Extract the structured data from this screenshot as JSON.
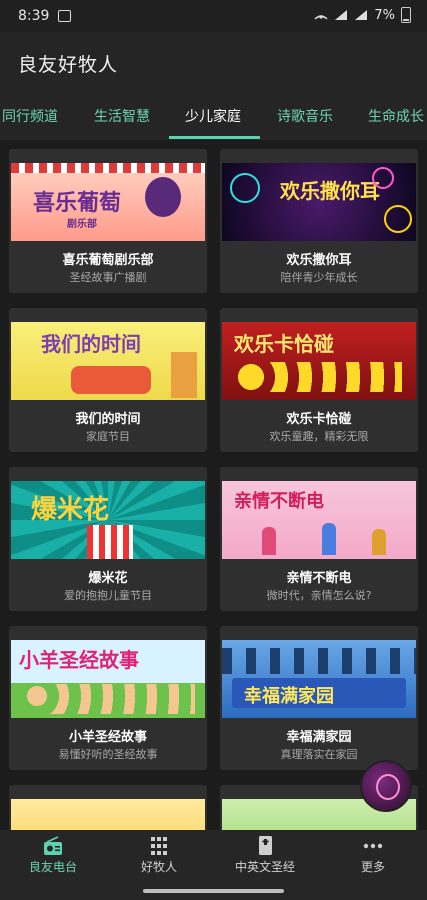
{
  "status": {
    "time": "8:39",
    "battery": "7%"
  },
  "appbar": {
    "title": "良友好牧人"
  },
  "tabs": [
    {
      "label": "同行频道"
    },
    {
      "label": "生活智慧"
    },
    {
      "label": "少儿家庭",
      "active": true
    },
    {
      "label": "诗歌音乐"
    },
    {
      "label": "生命成长"
    }
  ],
  "cards": [
    {
      "title": "喜乐葡萄剧乐部",
      "subtitle": "圣经故事广播剧",
      "banner_text": "喜乐葡萄",
      "banner_small": "剧乐部"
    },
    {
      "title": "欢乐撒你耳",
      "subtitle": "陪伴青少年成长",
      "banner_text": "欢乐撒你耳"
    },
    {
      "title": "我们的时间",
      "subtitle": "家庭节目",
      "banner_text": "我们的时间"
    },
    {
      "title": "欢乐卡恰碰",
      "subtitle": "欢乐童趣，精彩无限",
      "banner_text": "欢乐卡恰碰"
    },
    {
      "title": "爆米花",
      "subtitle": "爱的抱抱儿童节目",
      "banner_text": "爆米花"
    },
    {
      "title": "亲情不断电",
      "subtitle": "微时代，亲情怎么说?",
      "banner_text": "亲情不断电"
    },
    {
      "title": "小羊圣经故事",
      "subtitle": "易懂好听的圣经故事",
      "banner_text": "小羊圣经故事"
    },
    {
      "title": "幸福满家园",
      "subtitle": "真理落实在家园",
      "banner_text": "幸福满家园"
    }
  ],
  "bottomnav": [
    {
      "label": "良友电台",
      "icon": "radio-icon",
      "active": true
    },
    {
      "label": "好牧人",
      "icon": "grid-icon"
    },
    {
      "label": "中英文圣经",
      "icon": "book-icon"
    },
    {
      "label": "更多",
      "icon": "more-icon"
    }
  ],
  "colors": {
    "accent": "#5ed0ae",
    "background": "#1c1c1c",
    "card": "#2f2f2f"
  }
}
